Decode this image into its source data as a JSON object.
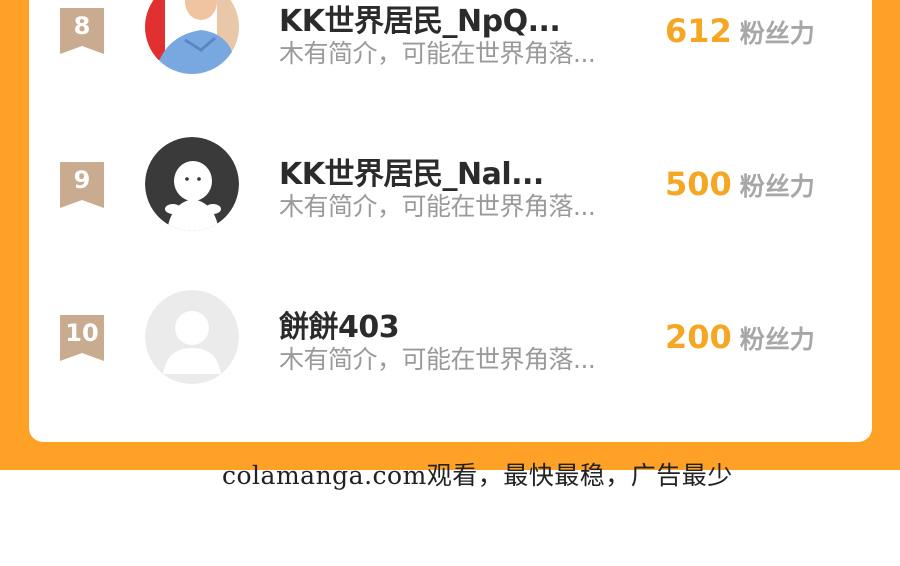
{
  "rows": [
    {
      "rank": "8",
      "name": "KK世界居民_NpQ...",
      "bio": "木有简介，可能在世界角落...",
      "score": "612",
      "score_label": "粉丝力",
      "avatar": "photo-avatar-icon"
    },
    {
      "rank": "9",
      "name": "KK世界居民_Nal...",
      "bio": "木有简介，可能在世界角落...",
      "score": "500",
      "score_label": "粉丝力",
      "avatar": "ghost-avatar-icon"
    },
    {
      "rank": "10",
      "name": "餅餅403",
      "bio": "木有简介，可能在世界角落...",
      "score": "200",
      "score_label": "粉丝力",
      "avatar": "default-user-avatar-icon"
    }
  ],
  "watermark": "colamanga.com观看，最快最稳，广告最少",
  "colors": {
    "background": "#ffa126",
    "card": "#ffffff",
    "score": "#f5a623",
    "badge": "#c9ab8f"
  }
}
